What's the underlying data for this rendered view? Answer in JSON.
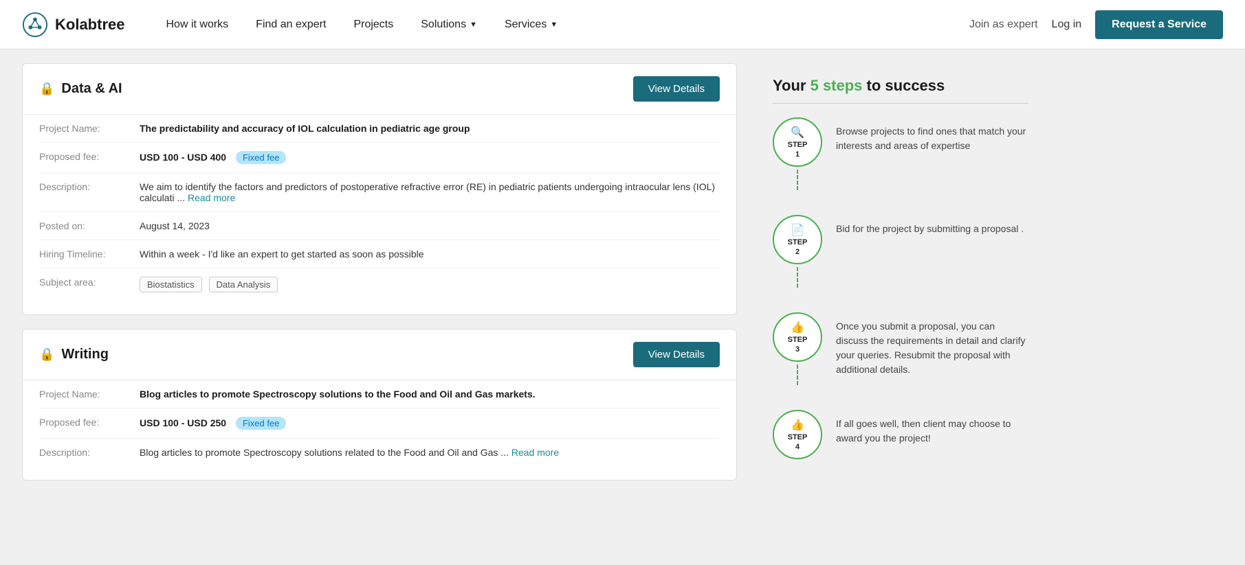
{
  "navbar": {
    "logo_text": "Kolabtree",
    "nav_items": [
      {
        "label": "How it works",
        "has_dropdown": false
      },
      {
        "label": "Find an expert",
        "has_dropdown": false
      },
      {
        "label": "Projects",
        "has_dropdown": false
      },
      {
        "label": "Solutions",
        "has_dropdown": true
      },
      {
        "label": "Services",
        "has_dropdown": true
      }
    ],
    "join_expert_label": "Join as expert",
    "login_label": "Log in",
    "request_service_label": "Request a Service"
  },
  "projects": [
    {
      "category": "Data & AI",
      "view_details_label": "View Details",
      "fields": {
        "project_name_label": "Project Name:",
        "project_name_value": "The predictability and accuracy of IOL calculation in pediatric age group",
        "proposed_fee_label": "Proposed fee:",
        "proposed_fee_value": "USD 100 - USD 400",
        "fee_badge": "Fixed fee",
        "description_label": "Description:",
        "description_value": "We aim to identify the factors and predictors of postoperative refractive error (RE) in pediatric patients undergoing intraocular lens (IOL) calculati ...",
        "read_more_label": "Read more",
        "posted_on_label": "Posted on:",
        "posted_on_value": "August 14, 2023",
        "hiring_timeline_label": "Hiring Timeline:",
        "hiring_timeline_value": "Within a week - I'd like an expert to get started as soon as possible",
        "subject_area_label": "Subject area:",
        "subject_tags": [
          "Biostatistics",
          "Data Analysis"
        ]
      }
    },
    {
      "category": "Writing",
      "view_details_label": "View Details",
      "fields": {
        "project_name_label": "Project Name:",
        "project_name_value": "Blog articles to promote Spectroscopy solutions to the Food and Oil and Gas markets.",
        "proposed_fee_label": "Proposed fee:",
        "proposed_fee_value": "USD 100 - USD 250",
        "fee_badge": "Fixed fee",
        "description_label": "Description:",
        "description_value": "Blog articles to promote Spectroscopy solutions related to the Food and Oil and Gas ...",
        "read_more_label": "Read more"
      }
    }
  ],
  "steps_panel": {
    "title_prefix": "Your ",
    "title_highlight": "5 steps",
    "title_suffix": " to success",
    "steps": [
      {
        "number": "STEP\n1",
        "icon": "🔍",
        "text": "Browse projects to find ones that match your interests and areas of expertise"
      },
      {
        "number": "STEP\n2",
        "icon": "📄",
        "text": "Bid for the project by submitting a proposal ."
      },
      {
        "number": "STEP\n3",
        "icon": "👍",
        "text": "Once you submit a proposal, you can discuss the requirements in detail and clarify your queries. Resubmit the proposal with additional details."
      },
      {
        "number": "STEP\n4",
        "icon": "👍",
        "text": "If all goes well, then client may choose to award you the project!"
      }
    ]
  }
}
